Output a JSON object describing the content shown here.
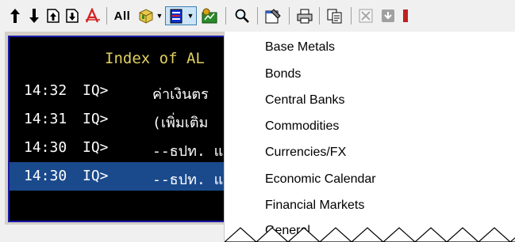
{
  "toolbar": {
    "all_label": "All",
    "icons": [
      "arrow-up-icon",
      "arrow-down-icon",
      "page-up-icon",
      "page-down-icon",
      "font-style-icon",
      "categories-icon",
      "news-filter-icon",
      "chart-icon",
      "search-icon",
      "properties-icon",
      "print-icon",
      "copy-icon",
      "delete-icon",
      "download-icon",
      "stop-icon"
    ]
  },
  "news": {
    "title": "Index of AL",
    "rows": [
      {
        "time": "14:32",
        "code": "IQ>",
        "text": "ค่าเงินตร"
      },
      {
        "time": "14:31",
        "code": "IQ>",
        "text": "(เพิ่มเติม"
      },
      {
        "time": "14:30",
        "code": "IQ>",
        "text": "--ธปท. แ"
      },
      {
        "time": "14:30",
        "code": "IQ>",
        "text": "--ธปท. แ"
      }
    ]
  },
  "menu": {
    "items": [
      "Base Metals",
      "Bonds",
      "Central Banks",
      "Commodities",
      "Currencies/FX",
      "Economic Calendar",
      "Financial Markets",
      "General"
    ]
  },
  "colors": {
    "news_bg": "#000000",
    "news_title": "#e0d060",
    "highlight_row": "#1a4a8c",
    "window_border": "#1a1aa8"
  }
}
